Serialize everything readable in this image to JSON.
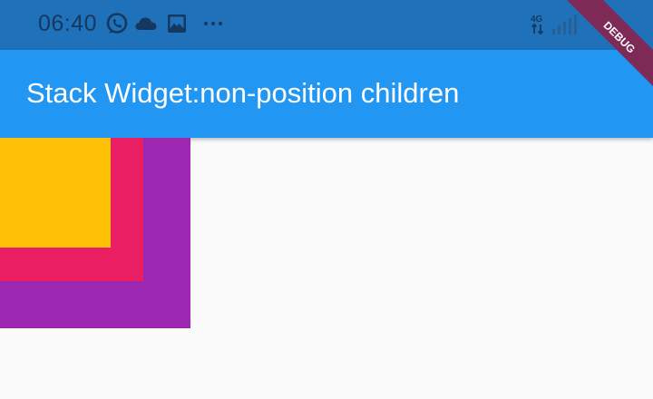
{
  "status_bar": {
    "time": "06:40",
    "network_type": "4G",
    "icons": [
      "whatsapp-icon",
      "cloud-icon",
      "image-icon",
      "more-icon",
      "network-4g-icon",
      "signal-icon"
    ],
    "color": "#1f72b9"
  },
  "app_bar": {
    "title": "Stack Widget:non-position children",
    "color": "#2196f3"
  },
  "debug_banner": {
    "label": "DEBUG",
    "color": "#7d2a56"
  },
  "stack": {
    "children": [
      {
        "name": "purple-box",
        "color": "#9c27b0"
      },
      {
        "name": "pink-box",
        "color": "#e91e63"
      },
      {
        "name": "amber-box",
        "color": "#ffc107"
      }
    ]
  },
  "background_color": "#fafafa"
}
